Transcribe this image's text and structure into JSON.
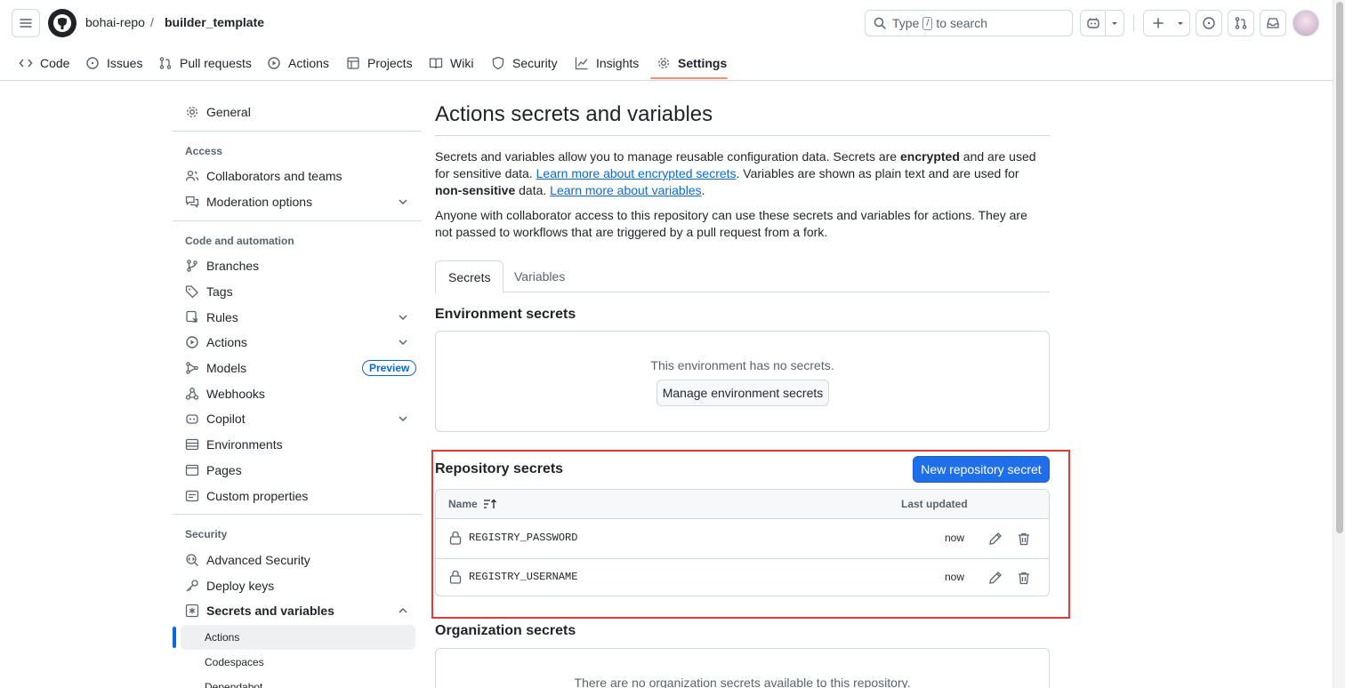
{
  "header": {
    "owner": "bohai-repo",
    "separator": "/",
    "repo": "builder_template",
    "search": {
      "prefix": "Type",
      "key": "/",
      "suffix": "to search"
    }
  },
  "repo_nav": {
    "items": [
      {
        "label": "Code",
        "icon": "code-icon"
      },
      {
        "label": "Issues",
        "icon": "issue-icon"
      },
      {
        "label": "Pull requests",
        "icon": "pull-request-icon"
      },
      {
        "label": "Actions",
        "icon": "play-icon"
      },
      {
        "label": "Projects",
        "icon": "table-icon"
      },
      {
        "label": "Wiki",
        "icon": "book-icon"
      },
      {
        "label": "Security",
        "icon": "shield-icon"
      },
      {
        "label": "Insights",
        "icon": "graph-icon"
      },
      {
        "label": "Settings",
        "icon": "gear-icon",
        "active": true
      }
    ]
  },
  "sidebar": {
    "general": "General",
    "access_heading": "Access",
    "collaborators": "Collaborators and teams",
    "moderation": "Moderation options",
    "code_heading": "Code and automation",
    "branches": "Branches",
    "tags": "Tags",
    "rules": "Rules",
    "actions": "Actions",
    "models": "Models",
    "models_badge": "Preview",
    "webhooks": "Webhooks",
    "copilot": "Copilot",
    "environments": "Environments",
    "pages": "Pages",
    "custom_properties": "Custom properties",
    "security_heading": "Security",
    "advanced_security": "Advanced Security",
    "deploy_keys": "Deploy keys",
    "secrets_and_variables": "Secrets and variables",
    "sub_actions": "Actions",
    "sub_codespaces": "Codespaces",
    "sub_dependabot": "Dependabot"
  },
  "main": {
    "title": "Actions secrets and variables",
    "intro": {
      "p1_a": "Secrets and variables allow you to manage reusable configuration data. Secrets are ",
      "p1_b": "encrypted",
      "p1_c": " and are used for sensitive data. ",
      "p1_link1": "Learn more about encrypted secrets",
      "p1_d": ". Variables are shown as plain text and are used for ",
      "p1_e": "non-sensitive",
      "p1_f": " data. ",
      "p1_link2": "Learn more about variables",
      "p1_g": ".",
      "p2": "Anyone with collaborator access to this repository can use these secrets and variables for actions. They are not passed to workflows that are triggered by a pull request from a fork."
    },
    "tabs": {
      "secrets": "Secrets",
      "variables": "Variables"
    },
    "env_secrets": {
      "title": "Environment secrets",
      "empty": "This environment has no secrets.",
      "button": "Manage environment secrets"
    },
    "repo_secrets": {
      "title": "Repository secrets",
      "new_button": "New repository secret",
      "col_name": "Name",
      "col_updated": "Last updated",
      "rows": [
        {
          "name": "REGISTRY_PASSWORD",
          "updated": "now"
        },
        {
          "name": "REGISTRY_USERNAME",
          "updated": "now"
        }
      ]
    },
    "org_secrets": {
      "title": "Organization secrets",
      "empty": "There are no organization secrets available to this repository."
    }
  },
  "colors": {
    "accent": "#0969da",
    "primary_button": "#1f6feb",
    "selected_underline": "#fd8c73",
    "highlight_box": "#e53935"
  }
}
